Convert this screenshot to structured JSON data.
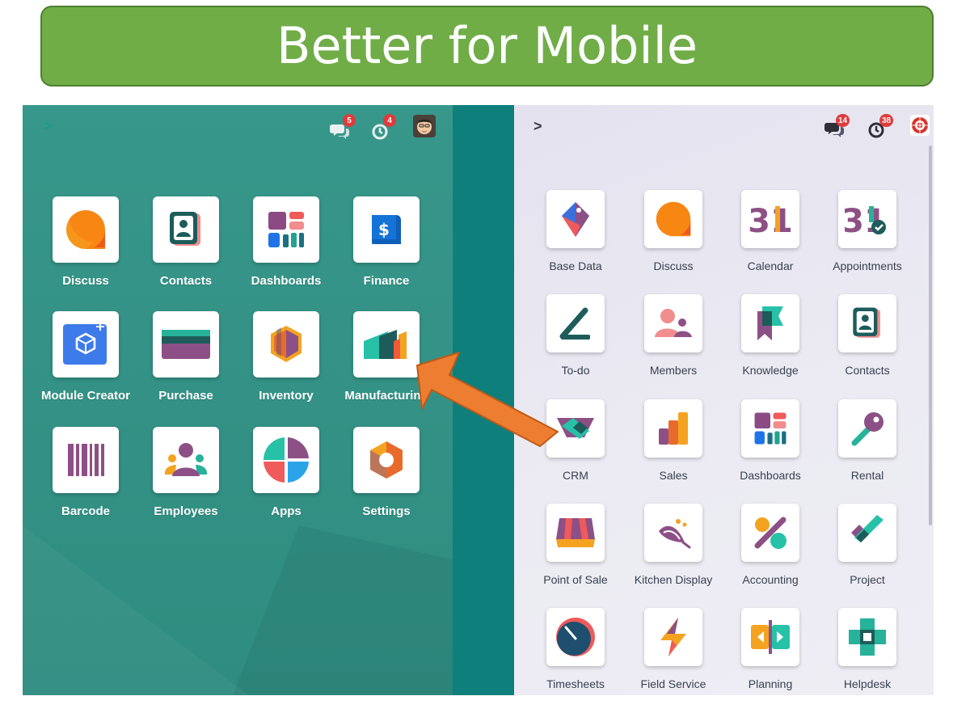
{
  "banner": {
    "title": "Better for Mobile"
  },
  "left_phone": {
    "chevron": ">",
    "discuss_badge": "5",
    "activity_badge": "4",
    "apps": [
      {
        "label": "Discuss",
        "icon": "discuss-icon"
      },
      {
        "label": "Contacts",
        "icon": "contacts-icon"
      },
      {
        "label": "Dashboards",
        "icon": "dashboards-icon"
      },
      {
        "label": "Finance",
        "icon": "finance-icon"
      },
      {
        "label": "Module Creator",
        "icon": "module-creator-icon"
      },
      {
        "label": "Purchase",
        "icon": "purchase-icon"
      },
      {
        "label": "Inventory",
        "icon": "inventory-icon"
      },
      {
        "label": "Manufacturing",
        "icon": "manufacturing-icon"
      },
      {
        "label": "Barcode",
        "icon": "barcode-icon"
      },
      {
        "label": "Employees",
        "icon": "employees-icon"
      },
      {
        "label": "Apps",
        "icon": "apps-icon"
      },
      {
        "label": "Settings",
        "icon": "settings-icon"
      }
    ]
  },
  "right_phone": {
    "chevron": ">",
    "discuss_badge": "14",
    "activity_badge": "38",
    "apps": [
      {
        "label": "Base Data",
        "icon": "base-data-icon"
      },
      {
        "label": "Discuss",
        "icon": "discuss-icon"
      },
      {
        "label": "Calendar",
        "icon": "calendar-icon",
        "text": "31"
      },
      {
        "label": "Appointments",
        "icon": "appointments-icon",
        "text": "31"
      },
      {
        "label": "To-do",
        "icon": "todo-icon"
      },
      {
        "label": "Members",
        "icon": "members-icon"
      },
      {
        "label": "Knowledge",
        "icon": "knowledge-icon"
      },
      {
        "label": "Contacts",
        "icon": "contacts-icon"
      },
      {
        "label": "CRM",
        "icon": "crm-icon"
      },
      {
        "label": "Sales",
        "icon": "sales-icon"
      },
      {
        "label": "Dashboards",
        "icon": "dashboards-icon"
      },
      {
        "label": "Rental",
        "icon": "rental-icon"
      },
      {
        "label": "Point of Sale",
        "icon": "point-of-sale-icon"
      },
      {
        "label": "Kitchen Display",
        "icon": "kitchen-display-icon"
      },
      {
        "label": "Accounting",
        "icon": "accounting-icon"
      },
      {
        "label": "Project",
        "icon": "project-icon"
      },
      {
        "label": "Timesheets",
        "icon": "timesheets-icon"
      },
      {
        "label": "Field Service",
        "icon": "field-service-icon"
      },
      {
        "label": "Planning",
        "icon": "planning-icon"
      },
      {
        "label": "Helpdesk",
        "icon": "helpdesk-icon"
      }
    ]
  },
  "colors": {
    "banner": "#70ad47",
    "teal": "#37978a",
    "arrow": "#ed7d31"
  }
}
